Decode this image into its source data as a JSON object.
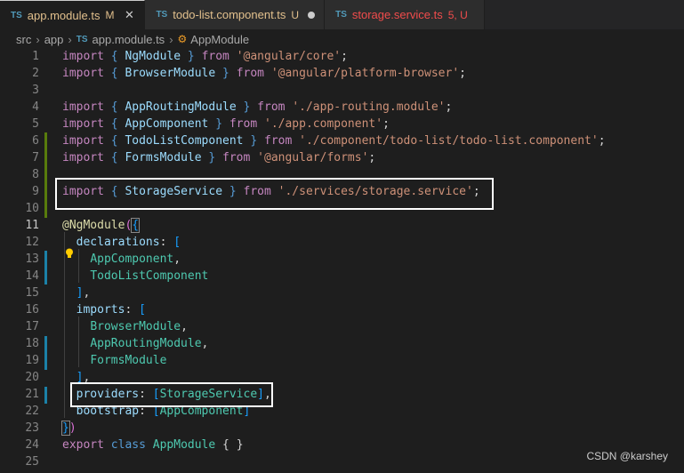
{
  "tabs": [
    {
      "ts": "TS",
      "name": "app.module.ts",
      "badge": "M",
      "control": "✕",
      "active": true
    },
    {
      "ts": "TS",
      "name": "todo-list.component.ts",
      "badge": "U",
      "control": "dot",
      "active": false
    },
    {
      "ts": "TS",
      "name": "storage.service.ts",
      "badge": "5, U",
      "control": "",
      "active": false
    }
  ],
  "breadcrumb": {
    "src": "src",
    "app": "app",
    "file_ts": "TS",
    "file": "app.module.ts",
    "symbol": "AppModule"
  },
  "code": {
    "l1": {
      "n": "1",
      "a": "import",
      "b": "{",
      "c": "NgModule",
      "d": "}",
      "e": "from",
      "f": "'@angular/core'",
      "g": ";"
    },
    "l2": {
      "n": "2",
      "a": "import",
      "b": "{",
      "c": "BrowserModule",
      "d": "}",
      "e": "from",
      "f": "'@angular/platform-browser'",
      "g": ";"
    },
    "l3": {
      "n": "3"
    },
    "l4": {
      "n": "4",
      "a": "import",
      "b": "{",
      "c": "AppRoutingModule",
      "d": "}",
      "e": "from",
      "f": "'./app-routing.module'",
      "g": ";"
    },
    "l5": {
      "n": "5",
      "a": "import",
      "b": "{",
      "c": "AppComponent",
      "d": "}",
      "e": "from",
      "f": "'./app.component'",
      "g": ";"
    },
    "l6": {
      "n": "6",
      "a": "import",
      "b": "{",
      "c": "TodoListComponent",
      "d": "}",
      "e": "from",
      "f": "'./component/todo-list/todo-list.component'",
      "g": ";"
    },
    "l7": {
      "n": "7",
      "a": "import",
      "b": "{",
      "c": "FormsModule",
      "d": "}",
      "e": "from",
      "f": "'@angular/forms'",
      "g": ";"
    },
    "l8": {
      "n": "8"
    },
    "l9": {
      "n": "9",
      "a": "import",
      "b": "{",
      "c": "StorageService",
      "d": "}",
      "e": "from",
      "f": "'./services/storage.service'",
      "g": ";"
    },
    "l10": {
      "n": "10"
    },
    "l11": {
      "n": "11",
      "at": "@",
      "dec": "NgModule",
      "p": "(",
      "b": "{"
    },
    "l12": {
      "n": "12",
      "key": "declarations",
      "colon": ":",
      "br": "["
    },
    "l13": {
      "n": "13",
      "v": "AppComponent",
      "c": ","
    },
    "l14": {
      "n": "14",
      "v": "TodoListComponent"
    },
    "l15": {
      "n": "15",
      "br": "]",
      "c": ","
    },
    "l16": {
      "n": "16",
      "key": "imports",
      "colon": ":",
      "br": "["
    },
    "l17": {
      "n": "17",
      "v": "BrowserModule",
      "c": ","
    },
    "l18": {
      "n": "18",
      "v": "AppRoutingModule",
      "c": ","
    },
    "l19": {
      "n": "19",
      "v": "FormsModule"
    },
    "l20": {
      "n": "20",
      "br": "]",
      "c": ","
    },
    "l21": {
      "n": "21",
      "key": "providers",
      "colon": ":",
      "bo": "[",
      "v": "StorageService",
      "bc": "]",
      "c": ","
    },
    "l22": {
      "n": "22",
      "key": "bootstrap",
      "colon": ":",
      "bo": "[",
      "v": "AppComponent",
      "bc": "]"
    },
    "l23": {
      "n": "23",
      "b": "}",
      "p": ")"
    },
    "l24": {
      "n": "24",
      "a": "export",
      "k": "class",
      "cls": "AppModule",
      "b": "{ }"
    },
    "l25": {
      "n": "25"
    }
  },
  "watermark": "CSDN @karshey"
}
